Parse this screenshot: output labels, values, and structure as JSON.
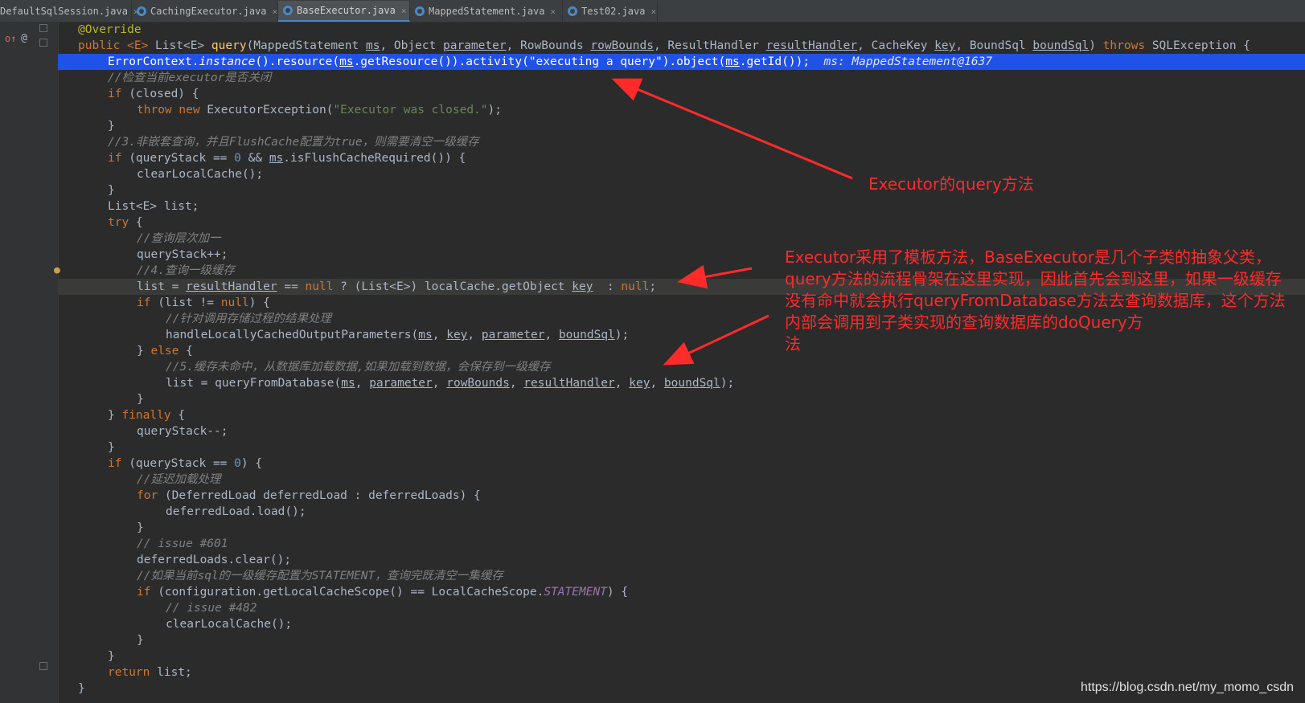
{
  "tabs": [
    {
      "label": "DefaultSqlSession.java"
    },
    {
      "label": "CachingExecutor.java"
    },
    {
      "label": "BaseExecutor.java",
      "active": true
    },
    {
      "label": "MappedStatement.java"
    },
    {
      "label": "Test02.java"
    }
  ],
  "code_lines": [
    "@Override",
    "public <E> List<E> query(MappedStatement ms, Object parameter, RowBounds rowBounds, ResultHandler resultHandler, CacheKey key, BoundSql boundSql) throws SQLException {",
    "ErrorContext.instance().resource(ms.getResource()).activity(\"executing a query\").object(ms.getId());",
    "//检查当前executor是否关闭",
    "if (closed) {",
    "throw new ExecutorException(\"Executor was closed.\");",
    "}",
    "//3.非嵌套查询，并且FlushCache配置为true，则需要清空一级缓存",
    "if (queryStack == 0 && ms.isFlushCacheRequired()) {",
    "clearLocalCache();",
    "}",
    "List<E> list;",
    "try {",
    "//查询层次加一",
    "queryStack++;",
    "//4.查询一级缓存",
    "list = resultHandler == null ? (List<E>) localCache.getObject key : null;",
    "if (list != null) {",
    "//针对调用存储过程的结果处理",
    "handleLocallyCachedOutputParameters(ms, key, parameter, boundSql);",
    "} else {",
    "//5.缓存未命中，从数据库加载数据,如果加载到数据，会保存到一级缓存",
    "list = queryFromDatabase(ms, parameter, rowBounds, resultHandler, key, boundSql);",
    "}",
    "} finally {",
    "queryStack--;",
    "}",
    "if (queryStack == 0) {",
    "//延迟加载处理",
    "for (DeferredLoad deferredLoad : deferredLoads) {",
    "deferredLoad.load();",
    "}",
    "// issue #601",
    "deferredLoads.clear();",
    "//如果当前sql的一级缓存配置为STATEMENT，查询完既清空一集缓存",
    "if (configuration.getLocalCacheScope() == LocalCacheScope.STATEMENT) {",
    "// issue #482",
    "clearLocalCache();",
    "}",
    "}",
    "return list;",
    "}"
  ],
  "inline_debug_value": "ms: MappedStatement@1637",
  "annotations": {
    "first": "Executor的query方法",
    "second_lines": [
      "Executor采用了模板方法，BaseExecutor是几个子类的抽象父类，",
      "query方法的流程骨架在这里实现，因此首先会到这里，如果一级缓存",
      "没有命中就会执行queryFromDatabase方法去查询数据库，这个方法",
      "内部会调用到子类实现的查询数据库的doQuery方",
      "法"
    ]
  },
  "watermark": "https://blog.csdn.net/my_momo_csdn",
  "colors": {
    "editor_bg": "#2b2b2b",
    "keyword": "#cc7832",
    "comment": "#808080",
    "string": "#6a8759",
    "number": "#6897bb",
    "annotation": "#bbb529",
    "execution_line": "#2152e8",
    "annotation_text": "#ff2a2a"
  }
}
